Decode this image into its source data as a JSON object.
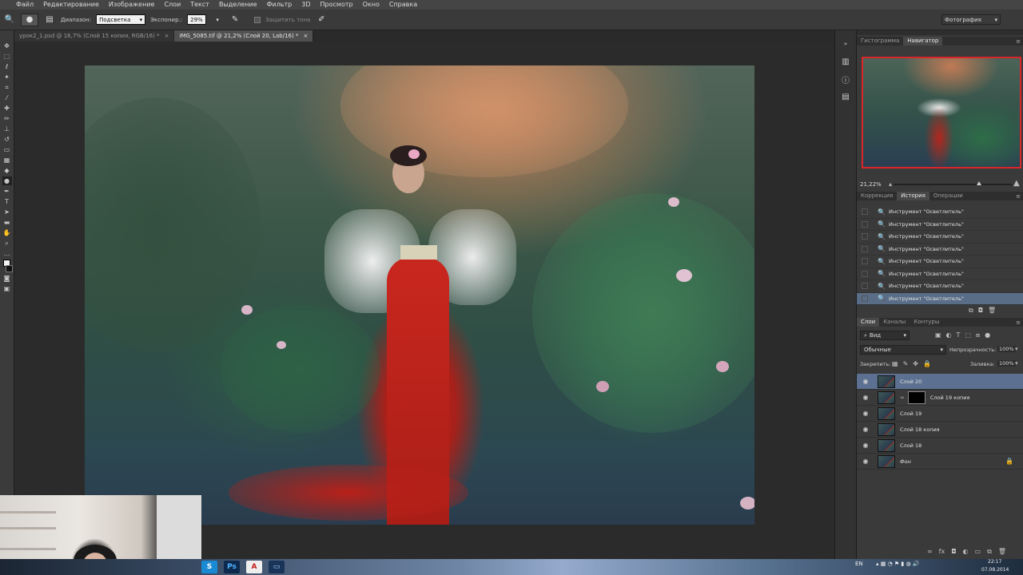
{
  "menu": {
    "items": [
      "Файл",
      "Редактирование",
      "Изображение",
      "Слои",
      "Текст",
      "Выделение",
      "Фильтр",
      "3D",
      "Просмотр",
      "Окно",
      "Справка"
    ]
  },
  "options_bar": {
    "range_label": "Диапазон:",
    "range_value": "Подсветка",
    "exposure_label": "Экспонир.:",
    "exposure_value": "29%",
    "protect_tones_label": "Защитить тона",
    "workspace_value": "Фотография"
  },
  "document_tabs": [
    {
      "label": "урок2_1.psd @ 16,7% (Слой 15 копия, RGB/16) *",
      "close": "×",
      "active": false
    },
    {
      "label": "IMG_5085.tif @ 21,2% (Слой 20, Lab/16) *",
      "close": "×",
      "active": true
    }
  ],
  "navigator": {
    "tabs": [
      "Гистограмма",
      "Навигатор"
    ],
    "active_tab": "Навигатор",
    "zoom": "21,22%",
    "zoom_fraction": 0.72
  },
  "history": {
    "tabs": [
      "Коррекция",
      "История",
      "Операции"
    ],
    "active_tab": "История",
    "items": [
      "Инструмент \"Осветлитель\"",
      "Инструмент \"Осветлитель\"",
      "Инструмент \"Осветлитель\"",
      "Инструмент \"Осветлитель\"",
      "Инструмент \"Осветлитель\"",
      "Инструмент \"Осветлитель\"",
      "Инструмент \"Осветлитель\"",
      "Инструмент \"Осветлитель\""
    ],
    "active_index": 7
  },
  "layers": {
    "tabs": [
      "Слои",
      "Каналы",
      "Контуры"
    ],
    "active_tab": "Слои",
    "filter_value": "Вид",
    "blend_mode": "Обычные",
    "opacity_label": "Непрозрачность:",
    "opacity_value": "100%",
    "lock_label": "Закрепить:",
    "fill_label": "Заливка:",
    "fill_value": "100%",
    "items": [
      {
        "name": "Слой 20",
        "selected": true,
        "mask": false,
        "locked": false
      },
      {
        "name": "Слой 19 копия",
        "selected": false,
        "mask": true,
        "locked": false
      },
      {
        "name": "Слой 19",
        "selected": false,
        "mask": false,
        "locked": false
      },
      {
        "name": "Слой 18 копия",
        "selected": false,
        "mask": false,
        "locked": false
      },
      {
        "name": "Слой 18",
        "selected": false,
        "mask": false,
        "locked": false
      },
      {
        "name": "Фон",
        "selected": false,
        "mask": false,
        "locked": true
      }
    ]
  },
  "taskbar": {
    "apps": [
      "S",
      "Ps",
      "A",
      "▭"
    ],
    "lang": "EN",
    "time": "22:17",
    "date": "07.08.2014"
  },
  "colors": {
    "selection": "#5c7191",
    "history_active": "#5a6d86",
    "navigator_frame": "#d9262a",
    "panel_bg": "#3a3a3a"
  }
}
